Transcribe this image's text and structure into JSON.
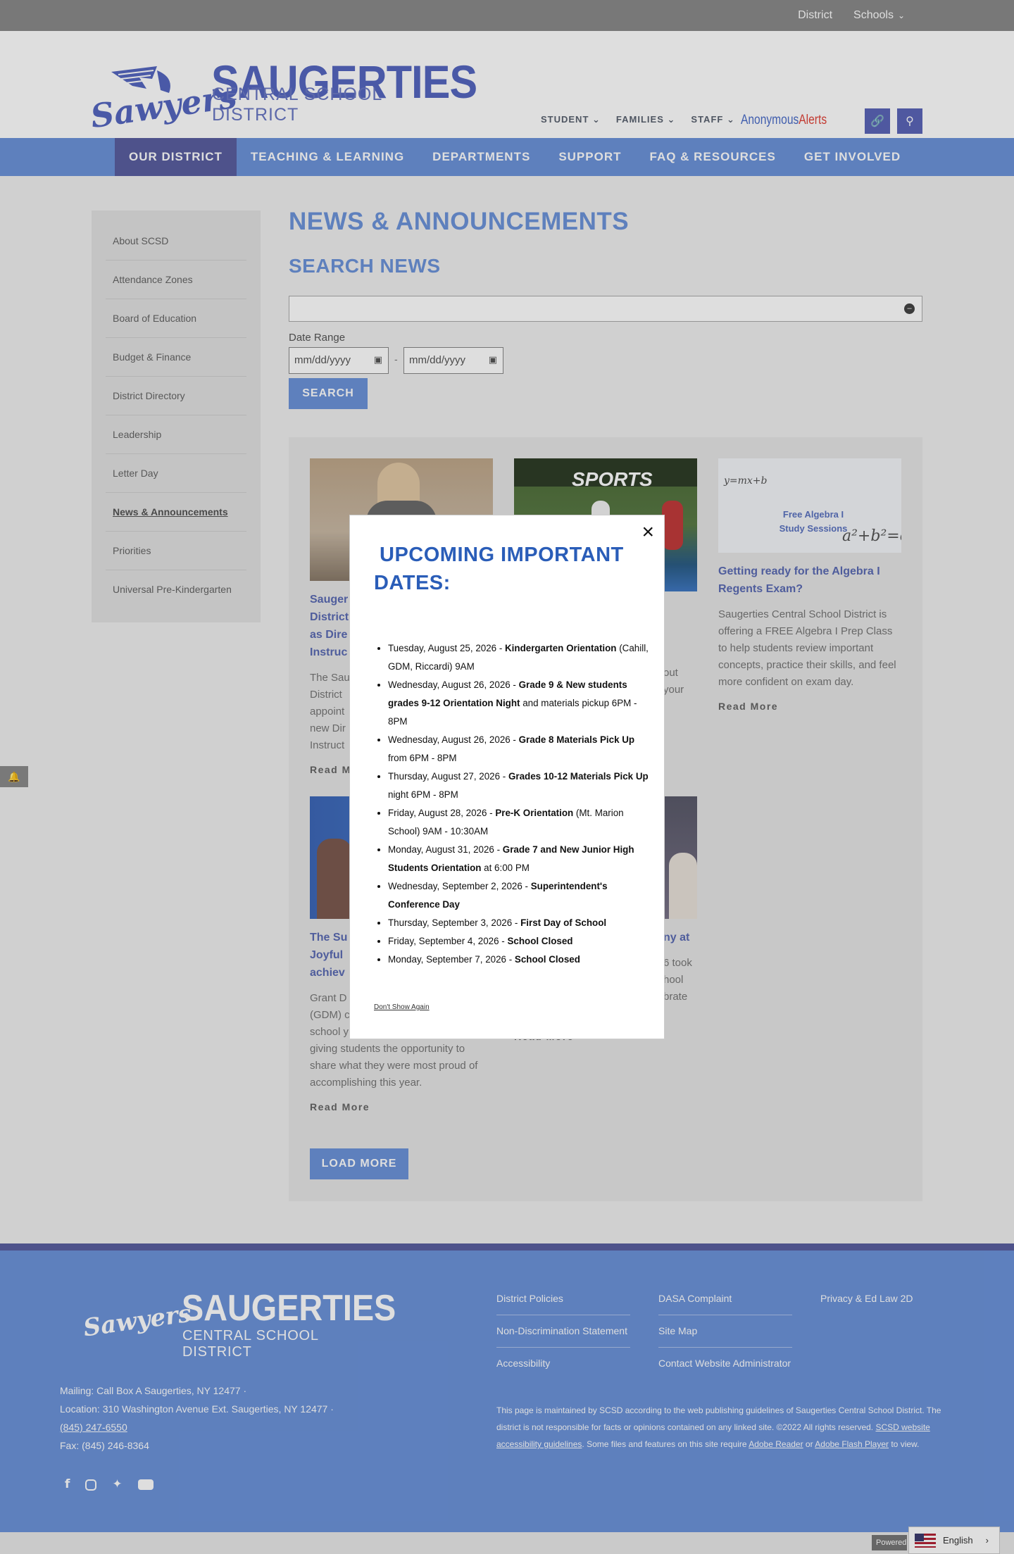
{
  "utility": {
    "district": "District",
    "schools": "Schools"
  },
  "logo": {
    "name": "SAUGERTIES",
    "sub": "CENTRAL SCHOOL DISTRICT",
    "script": "Sawyers"
  },
  "header_nav": [
    {
      "label": "STUDENT"
    },
    {
      "label": "FAMILIES"
    },
    {
      "label": "STAFF"
    }
  ],
  "alerts": {
    "part1": "Anonymous",
    "part2": "Alerts"
  },
  "main_nav": [
    {
      "label": "OUR DISTRICT",
      "active": true
    },
    {
      "label": "TEACHING & LEARNING"
    },
    {
      "label": "DEPARTMENTS"
    },
    {
      "label": "SUPPORT"
    },
    {
      "label": "FAQ & RESOURCES"
    },
    {
      "label": "GET INVOLVED"
    }
  ],
  "sidebar": [
    {
      "label": "About SCSD"
    },
    {
      "label": "Attendance Zones"
    },
    {
      "label": "Board of Education"
    },
    {
      "label": "Budget & Finance"
    },
    {
      "label": "District Directory"
    },
    {
      "label": "Leadership"
    },
    {
      "label": "Letter Day"
    },
    {
      "label": "News & Announcements",
      "active": true
    },
    {
      "label": "Priorities"
    },
    {
      "label": "Universal Pre-Kindergarten"
    }
  ],
  "page": {
    "title": "NEWS & ANNOUNCEMENTS",
    "search_heading": "SEARCH NEWS",
    "search_value": "",
    "date_range_label": "Date Range",
    "date_placeholder": "mm/dd/yyyy",
    "date_separator": "-",
    "search_button": "SEARCH",
    "load_more": "LOAD MORE"
  },
  "cards": [
    {
      "title": "Saugerties Central School District Appoints New Director as Director of Curriculum and Instruction",
      "title_visible": "Sauger\nDistrict\nas Dire\nInstruc",
      "body": "The Sau\nDistrict\nappoint\nnew Dir\nInstruct",
      "read_more": "Read M"
    },
    {
      "title": "",
      "img_label": "SPORTS",
      "body": "out\nyour",
      "read_more": ""
    },
    {
      "title": "Getting ready for the Algebra I Regents Exam?",
      "img_label": "Free Algebra I Study Sessions",
      "body": "Saugerties Central School District is offering a FREE Algebra I Prep Class to help students review important concepts, practice their skills, and feel more confident on exam day.",
      "read_more": "Read More"
    },
    {
      "title": "The Su\nJoyful\nachiev",
      "body": "Grant D\n(GDM) c\nschool y\ngiving students the opportunity to share what they were most proud of accomplishing this year.",
      "read_more": "Read More"
    },
    {
      "title": "ny at",
      "body": "6 took\nhool\nbrate",
      "read_more": "Read More"
    }
  ],
  "modal": {
    "title_line1": "UPCOMING IMPORTANT",
    "title_line2": "DATES:",
    "close": "×",
    "dont_show": "Don't Show Again",
    "items": [
      {
        "date": "Tuesday, August 25, 2026 - ",
        "bold": "Kindergarten Orientation",
        "rest": " (Cahill, GDM, Riccardi) 9AM"
      },
      {
        "date": "Wednesday, August 26, 2026 - ",
        "bold": "Grade 9 & New students grades 9-12 Orientation Night",
        "rest": " and materials pickup 6PM - 8PM"
      },
      {
        "date": "Wednesday, August 26, 2026 - ",
        "bold": "Grade 8 Materials Pick Up",
        "rest": " from 6PM - 8PM"
      },
      {
        "date": "Thursday, August 27, 2026 - ",
        "bold": "Grades 10-12 Materials Pick Up",
        "rest": " night 6PM - 8PM"
      },
      {
        "date": "Friday, August 28, 2026 - ",
        "bold": "Pre-K Orientation",
        "rest": " (Mt. Marion School) 9AM - 10:30AM"
      },
      {
        "date": "Monday, August 31, 2026 - ",
        "bold": "Grade 7 and New Junior High Students Orientation",
        "rest": " at 6:00 PM"
      },
      {
        "date": "Wednesday, September 2, 2026 - ",
        "bold": "Superintendent's Conference Day",
        "rest": ""
      },
      {
        "date": "Thursday, September 3, 2026 - ",
        "bold": "First Day of School",
        "rest": ""
      },
      {
        "date": "Friday, September 4, 2026 - ",
        "bold": "School Closed",
        "rest": ""
      },
      {
        "date": "Monday, September 7, 2026 - ",
        "bold": "School Closed",
        "rest": ""
      }
    ]
  },
  "footer": {
    "logo_name": "SAUGERTIES",
    "logo_sub": "CENTRAL SCHOOL DISTRICT",
    "logo_script": "Sawyers",
    "mailing": "Mailing: Call Box A Saugerties, NY 12477",
    "location": "Location: 310 Washington Avenue Ext. Saugerties, NY 12477",
    "phone": "(845) 247-6550",
    "fax": "Fax: (845) 246-8364",
    "col1": [
      "District Policies",
      "Non-Discrimination Statement",
      "Accessibility"
    ],
    "col2": [
      "DASA Complaint",
      "Site Map",
      "Contact Website Administrator"
    ],
    "col3": [
      "Privacy & Ed Law 2D"
    ],
    "note_a": "This page is maintained by SCSD according to the web publishing guidelines of Saugerties Central School District. The district is not responsible for facts or opinions contained on any linked site. ©2022 All rights reserved. ",
    "note_link1": "SCSD website accessibility guidelines",
    "note_b": ". Some files and features on this site require ",
    "note_link2": "Adobe Reader",
    "note_c": " or ",
    "note_link3": "Adobe Flash Player",
    "note_d": " to view."
  },
  "bottom": {
    "powered": "Powered",
    "language": "English"
  },
  "colors": {
    "brand_blue": "#6c93da",
    "brand_indigo": "#5a5fa0",
    "modal_title": "#2a5db8"
  },
  "icons": [
    "chevron-down-icon",
    "link-icon",
    "search-icon",
    "calendar-icon",
    "close-icon",
    "bell-icon",
    "facebook-icon",
    "instagram-icon",
    "twitter-icon",
    "youtube-icon",
    "chevron-right-icon"
  ]
}
